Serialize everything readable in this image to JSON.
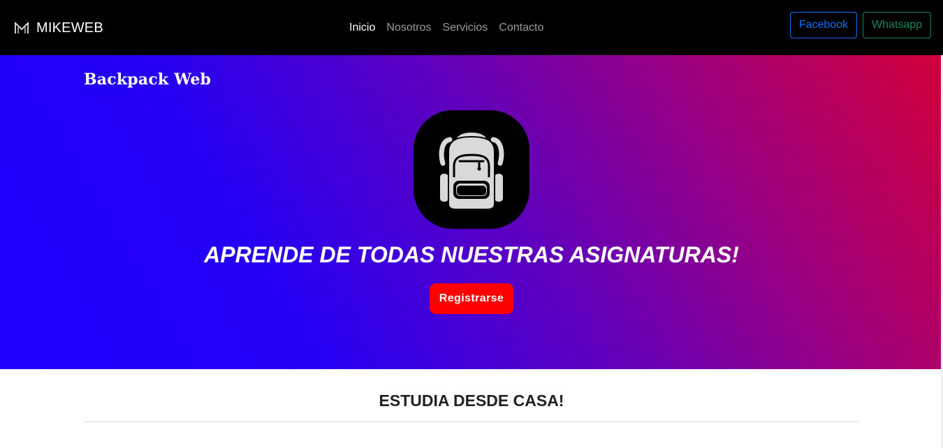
{
  "navbar": {
    "brand": {
      "logo_icon": "m-logo-icon",
      "text": "MIKEWEB"
    },
    "links": [
      {
        "label": "Inicio",
        "active": true
      },
      {
        "label": "Nosotros",
        "active": false
      },
      {
        "label": "Servicios",
        "active": false
      },
      {
        "label": "Contacto",
        "active": false
      }
    ],
    "social": {
      "facebook_label": "Facebook",
      "whatsapp_label": "Whatsapp"
    }
  },
  "hero": {
    "title": "Backpack Web",
    "logo_icon": "backpack-icon",
    "headline": "APRENDE DE TODAS NUESTRAS ASIGNATURAS!",
    "register_label": "Registrarse"
  },
  "section": {
    "heading": "ESTUDIA DESDE CASA!"
  },
  "colors": {
    "navbar_bg": "#000000",
    "facebook": "#0d6efd",
    "whatsapp": "#198754",
    "hero_gradient_start": "#1f00ff",
    "hero_gradient_end": "#d10039",
    "register_button": "#ff0000"
  }
}
